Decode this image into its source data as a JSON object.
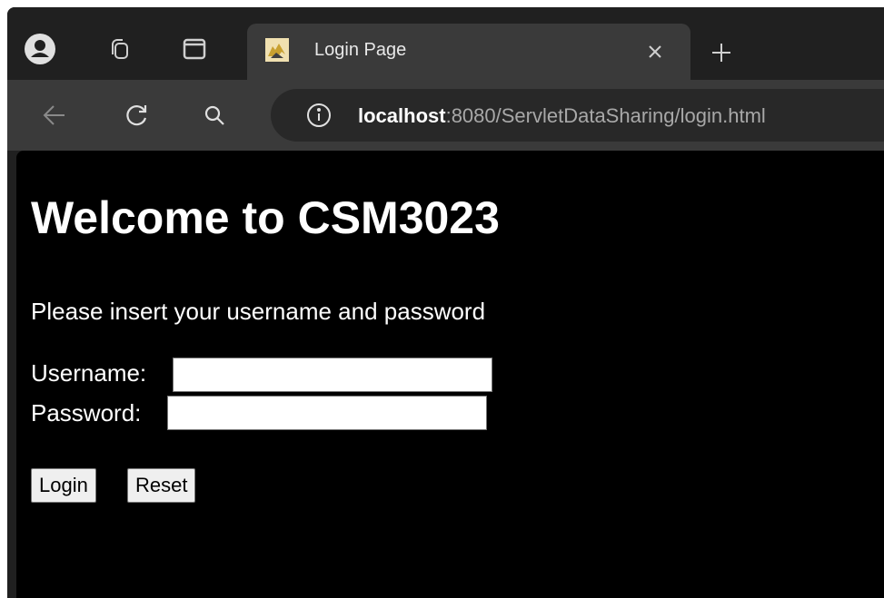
{
  "browser": {
    "tab_title": "Login Page",
    "url_host": "localhost",
    "url_rest": ":8080/ServletDataSharing/login.html"
  },
  "page": {
    "heading": "Welcome to CSM3023",
    "prompt": "Please insert your username and password",
    "username_label": "Username:",
    "password_label": "Password:",
    "username_value": "",
    "password_value": "",
    "login_label": "Login",
    "reset_label": "Reset"
  },
  "colors": {
    "browser_frame": "#202020",
    "toolbar": "#3a3a3a",
    "page_background": "#000000",
    "page_text": "#ffffff"
  },
  "icons": [
    "profile-icon",
    "tab-actions-icon",
    "vertical-tabs-icon",
    "tomcat-favicon-icon",
    "close-icon",
    "new-tab-icon",
    "back-icon",
    "reload-icon",
    "search-icon",
    "site-info-icon"
  ]
}
